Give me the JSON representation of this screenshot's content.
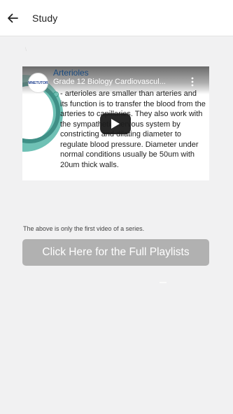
{
  "app_bar": {
    "title": "Study",
    "back_icon": "arrow-back-icon"
  },
  "video": {
    "slide_title": "Arterioles",
    "video_title": "Grade 12 Biology Cardiovascul...",
    "channel_logo_text": "MNETUTOR",
    "more_icon": "more-vert-icon",
    "play_icon": "play-icon",
    "slide_text": "- arterioles are smaller than arteries and its function is to transfer the blood from the arteries to capillaries. They also work with the sympathetic nervous system by constricting and dilating diameter to regulate blood pressure. Diameter under normal conditions usually be 50um with 20um thick walls."
  },
  "caption": "The above is only the first video of a series.",
  "playlist_button_label": "Click Here for the Full Playlists",
  "colors": {
    "background": "#f1f1f2",
    "button": "#b1b1b1",
    "accent_teal": "#6fc1b5",
    "play_button": "#1c1c1c"
  }
}
